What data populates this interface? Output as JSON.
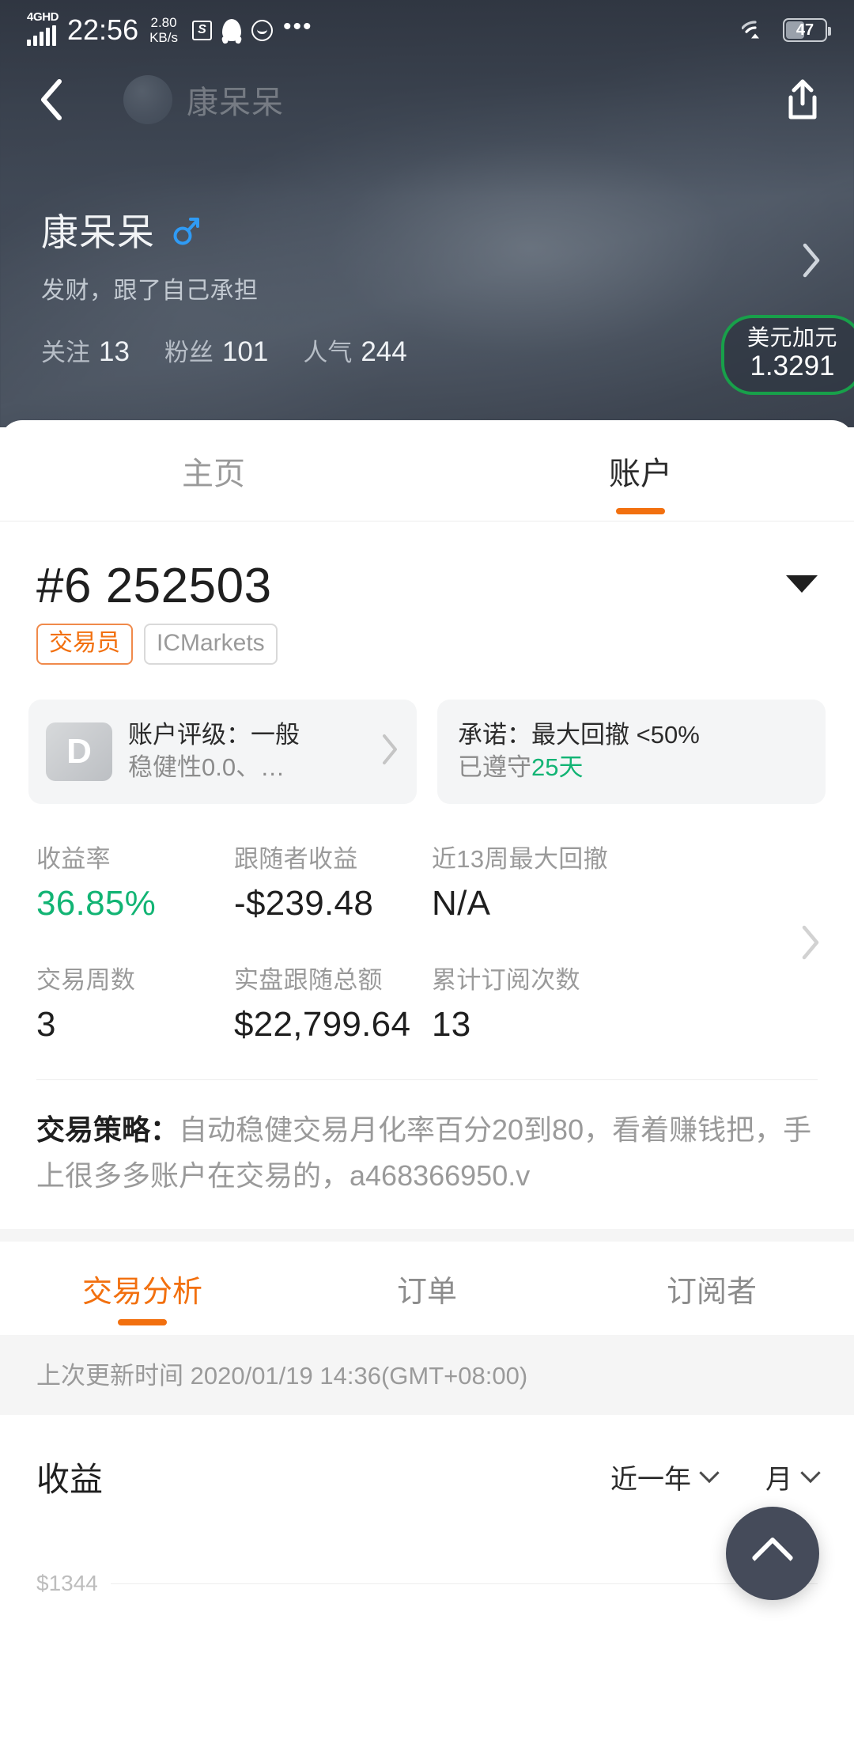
{
  "status_bar": {
    "network": "4GHD",
    "time": "22:56",
    "data_rate_value": "2.80",
    "data_rate_unit": "KB/s",
    "app_icon_1": "s-app-icon",
    "app_icon_2": "qq-penguin-icon",
    "app_icon_3": "chat-bubble-icon",
    "overflow": "•••",
    "wifi": "wifi-icon",
    "battery_level": "47"
  },
  "nav": {
    "back_icon": "back-chevron-icon",
    "title": "康呆呆",
    "share_icon": "share-icon"
  },
  "profile": {
    "name": "康呆呆",
    "gender_icon": "male-symbol-icon",
    "bio": "发财，跟了自己承担",
    "stats": [
      {
        "label": "关注",
        "value": "13"
      },
      {
        "label": "粉丝",
        "value": "101"
      },
      {
        "label": "人气",
        "value": "244"
      }
    ],
    "chevron_icon": "chevron-right-icon",
    "fx_badge": {
      "name": "美元加元",
      "value": "1.3291",
      "border_color": "#18a04a"
    }
  },
  "main_tabs": [
    {
      "label": "主页",
      "active": false
    },
    {
      "label": "账户",
      "active": true
    }
  ],
  "account": {
    "id": "#6 252503",
    "caret_icon": "caret-down-icon",
    "tags": [
      {
        "label": "交易员",
        "type": "trader"
      },
      {
        "label": "ICMarkets",
        "type": "broker"
      }
    ]
  },
  "cards": {
    "rating": {
      "grade": "D",
      "line1": "账户评级：一般",
      "line2": "稳健性0.0、…",
      "chevron_icon": "chevron-right-icon"
    },
    "promise": {
      "line1": "承诺：最大回撤 <50%",
      "line2_prefix": "已遵守",
      "line2_highlight": "25天",
      "highlight_color": "#12b474"
    }
  },
  "metrics": {
    "row1": [
      {
        "label": "收益率",
        "value": "36.85%",
        "color": "#12b474"
      },
      {
        "label": "跟随者收益",
        "value": "-$239.48",
        "color": "#1f1f1f"
      },
      {
        "label": "近13周最大回撤",
        "value": "N/A",
        "color": "#1f1f1f"
      }
    ],
    "row2": [
      {
        "label": "交易周数",
        "value": "3",
        "color": "#1f1f1f"
      },
      {
        "label": "实盘跟随总额",
        "value": "$22,799.64",
        "color": "#1f1f1f"
      },
      {
        "label": "累计订阅次数",
        "value": "13",
        "color": "#1f1f1f"
      }
    ],
    "chevron_icon": "chevron-right-icon"
  },
  "strategy": {
    "label": "交易策略：",
    "text": "自动稳健交易月化率百分20到80，看着赚钱把，手上很多多账户在交易的，a468366950.v"
  },
  "sub_tabs": [
    {
      "label": "交易分析",
      "active": true
    },
    {
      "label": "订单",
      "active": false
    },
    {
      "label": "订阅者",
      "active": false
    }
  ],
  "updated": "上次更新时间 2020/01/19 14:36(GMT+08:00)",
  "earnings": {
    "title": "收益",
    "range_selector": "近一年",
    "period_selector": "月",
    "chevron_icon": "chevron-down-icon"
  },
  "fab": {
    "icon": "scroll-to-top-icon"
  },
  "chart_data": {
    "type": "line",
    "title": "收益",
    "ylabel": "",
    "xlabel": "",
    "y_tick_labels": [
      "$1344"
    ],
    "values": [],
    "categories": [],
    "range": "近一年",
    "period": "月",
    "grid": true,
    "note": "chart body is cut off below the visible screenshot area; only the top gridline label $1344 is rendered"
  }
}
